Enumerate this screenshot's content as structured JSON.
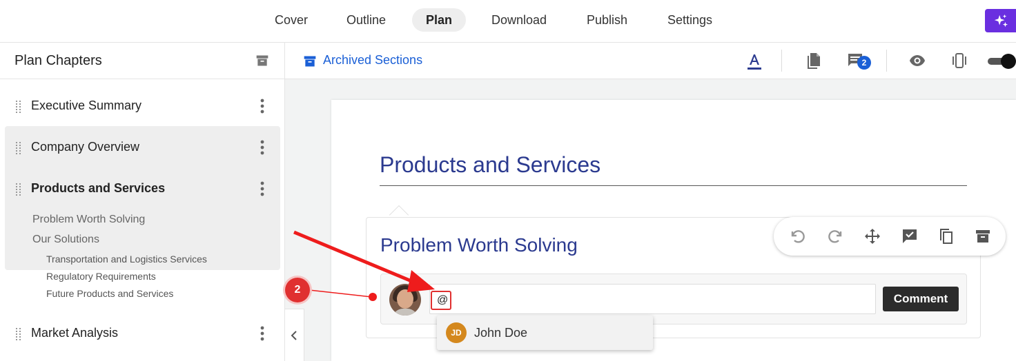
{
  "nav": {
    "tabs": [
      {
        "label": "Cover"
      },
      {
        "label": "Outline"
      },
      {
        "label": "Plan"
      },
      {
        "label": "Download"
      },
      {
        "label": "Publish"
      },
      {
        "label": "Settings"
      }
    ],
    "active_tab": "Plan"
  },
  "sidebar": {
    "title": "Plan Chapters",
    "chapters": [
      {
        "label": "Executive Summary"
      },
      {
        "label": "Company Overview"
      },
      {
        "label": "Products and Services"
      },
      {
        "label": "Market Analysis"
      }
    ],
    "sub_sections": [
      {
        "label": "Problem Worth Solving"
      },
      {
        "label": "Our Solutions"
      }
    ],
    "sub_sub_sections": [
      {
        "label": "Transportation and Logistics Services"
      },
      {
        "label": "Regulatory Requirements"
      },
      {
        "label": "Future Products and Services"
      }
    ]
  },
  "toolbar": {
    "archived_label": "Archived Sections",
    "comment_count": "2"
  },
  "editor": {
    "page_title": "Products and Services",
    "section_title": "Problem Worth Solving",
    "comment_input_value": "@",
    "comment_button": "Comment",
    "mention_suggestion": {
      "initials": "JD",
      "name": "John Doe"
    }
  },
  "annotation": {
    "step": "2"
  },
  "colors": {
    "accent_blue": "#1a5fd6",
    "heading_navy": "#2b3a8f",
    "ai_purple": "#6a2fe0",
    "annotation_red": "#e03030"
  }
}
